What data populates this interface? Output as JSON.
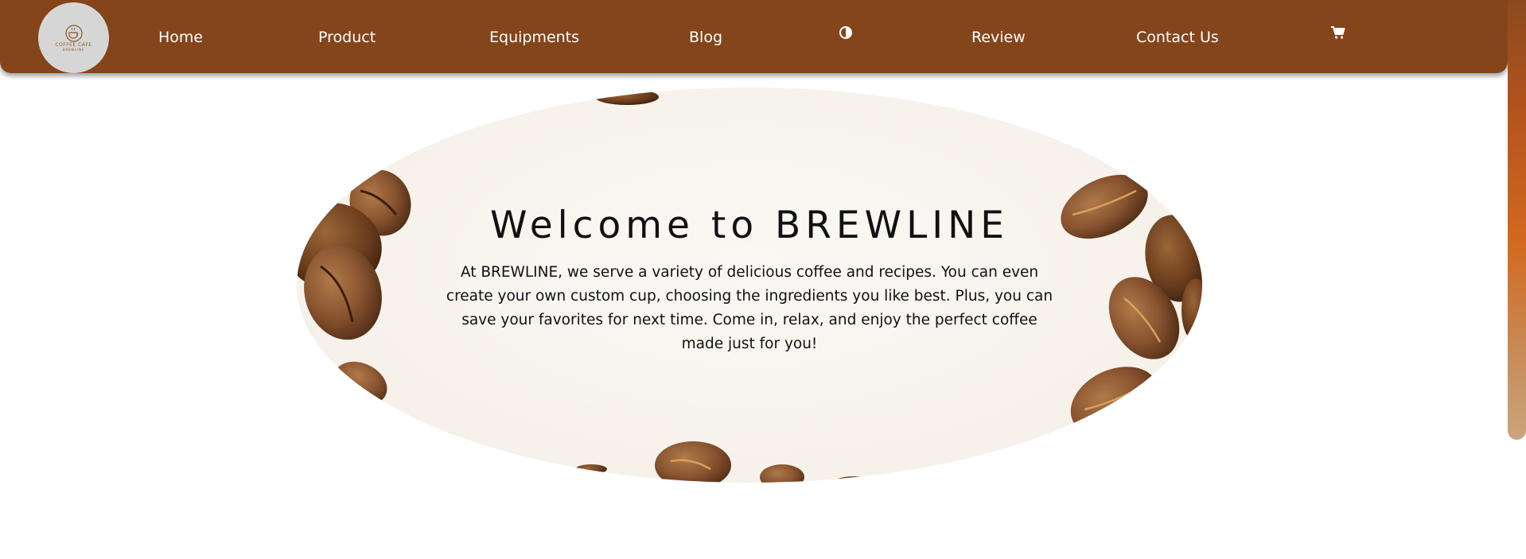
{
  "brand": {
    "logo_title": "COFFEE CAFE",
    "logo_subtitle": "BREWLINE"
  },
  "nav": {
    "home": "Home",
    "product": "Product",
    "equipments": "Equipments",
    "blog": "Blog",
    "theme_icon": "contrast-icon",
    "review": "Review",
    "contact": "Contact Us",
    "cart_icon": "cart-icon"
  },
  "hero": {
    "title": "Welcome to BREWLINE",
    "description": "At BREWLINE, we serve a variety of delicious coffee and recipes. You can even create your own custom cup, choosing the ingredients you like best. Plus, you can save your favorites for next time. Come in, relax, and enjoy the perfect coffee made just for you!"
  },
  "colors": {
    "navbar": "#84451b",
    "nav_text": "#ffffff",
    "hero_background": "#f6f1ea",
    "scrollbar_thumb": "#d2691e"
  }
}
